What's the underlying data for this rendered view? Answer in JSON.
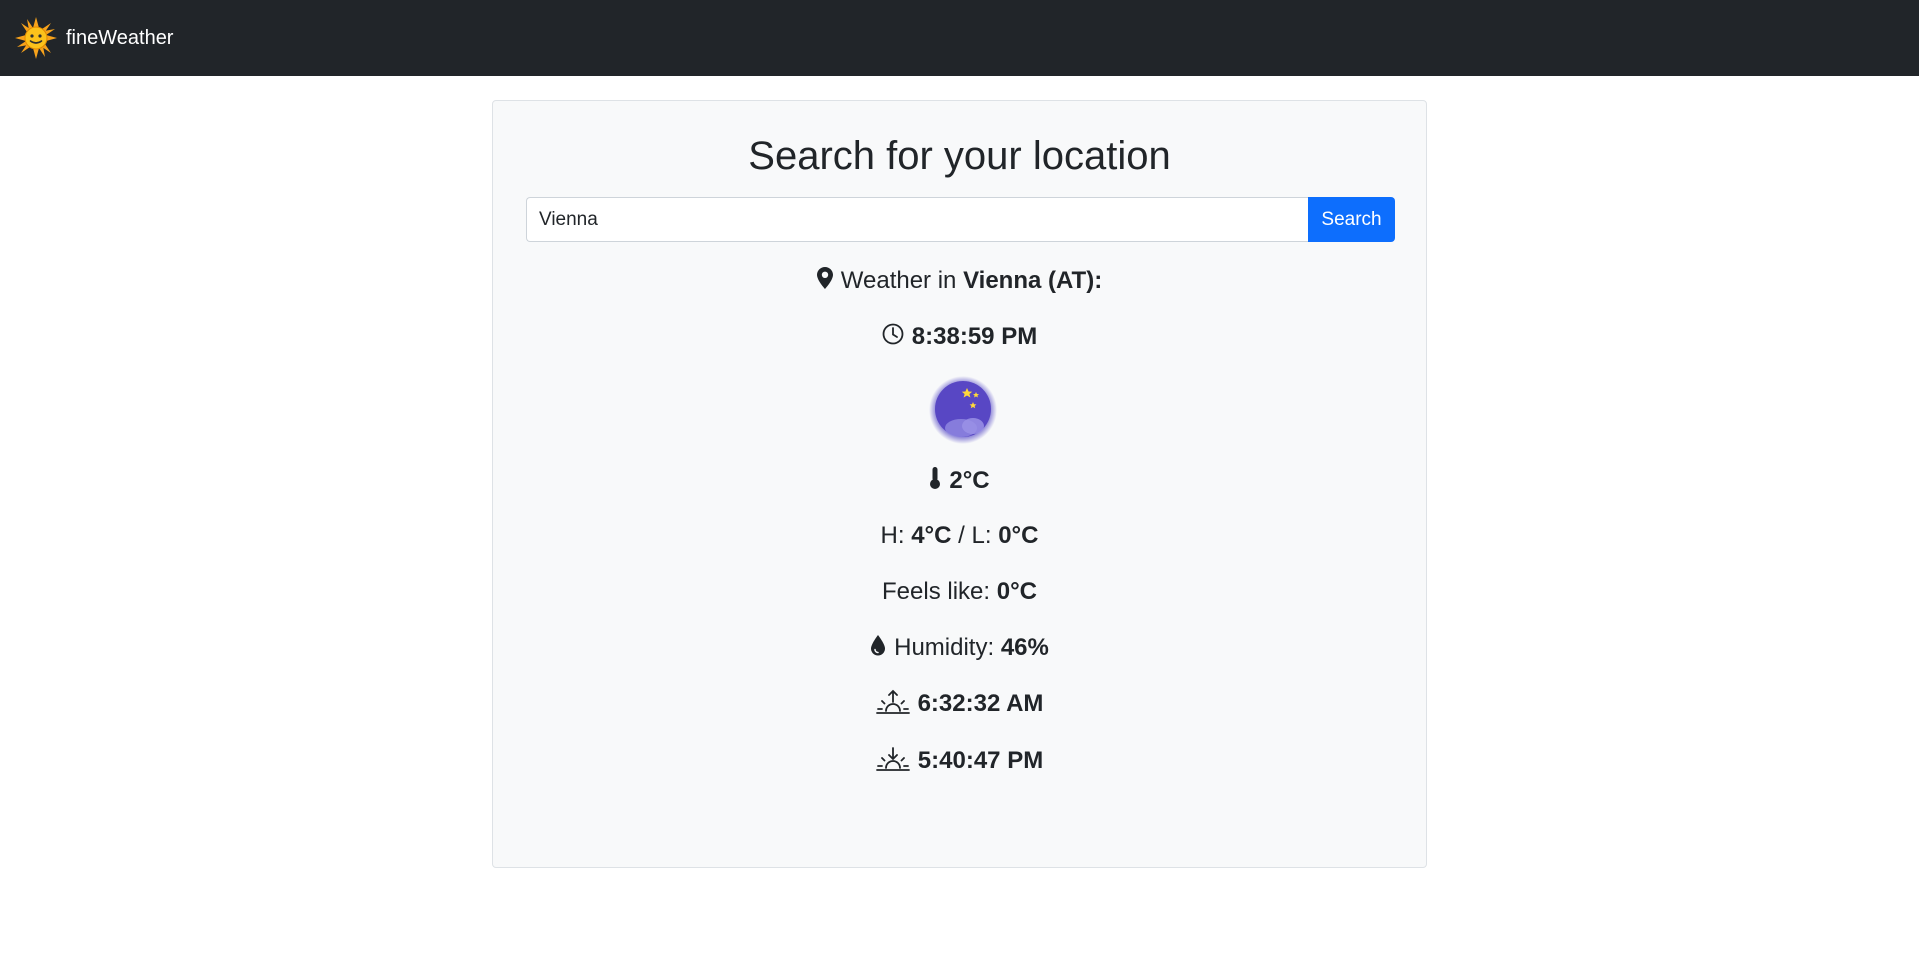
{
  "navbar": {
    "brand": "fineWeather"
  },
  "search": {
    "title": "Search for your location",
    "input_value": "Vienna",
    "button_label": "Search"
  },
  "weather": {
    "location_prefix": "Weather in",
    "location": "Vienna (AT):",
    "time": "8:38:59 PM",
    "icon": "night-moon-cloud-icon",
    "temperature": "2°C",
    "high_label": "H:",
    "high": "4°C",
    "low_label": "/ L:",
    "low": "0°C",
    "feels_like_label": "Feels like:",
    "feels_like": "0°C",
    "humidity_label": "Humidity:",
    "humidity": "46%",
    "sunrise": "6:32:32 AM",
    "sunset": "5:40:47 PM"
  },
  "colors": {
    "navbar_bg": "#212529",
    "card_bg": "#f8f9fa",
    "primary_button": "#0d6efd"
  }
}
